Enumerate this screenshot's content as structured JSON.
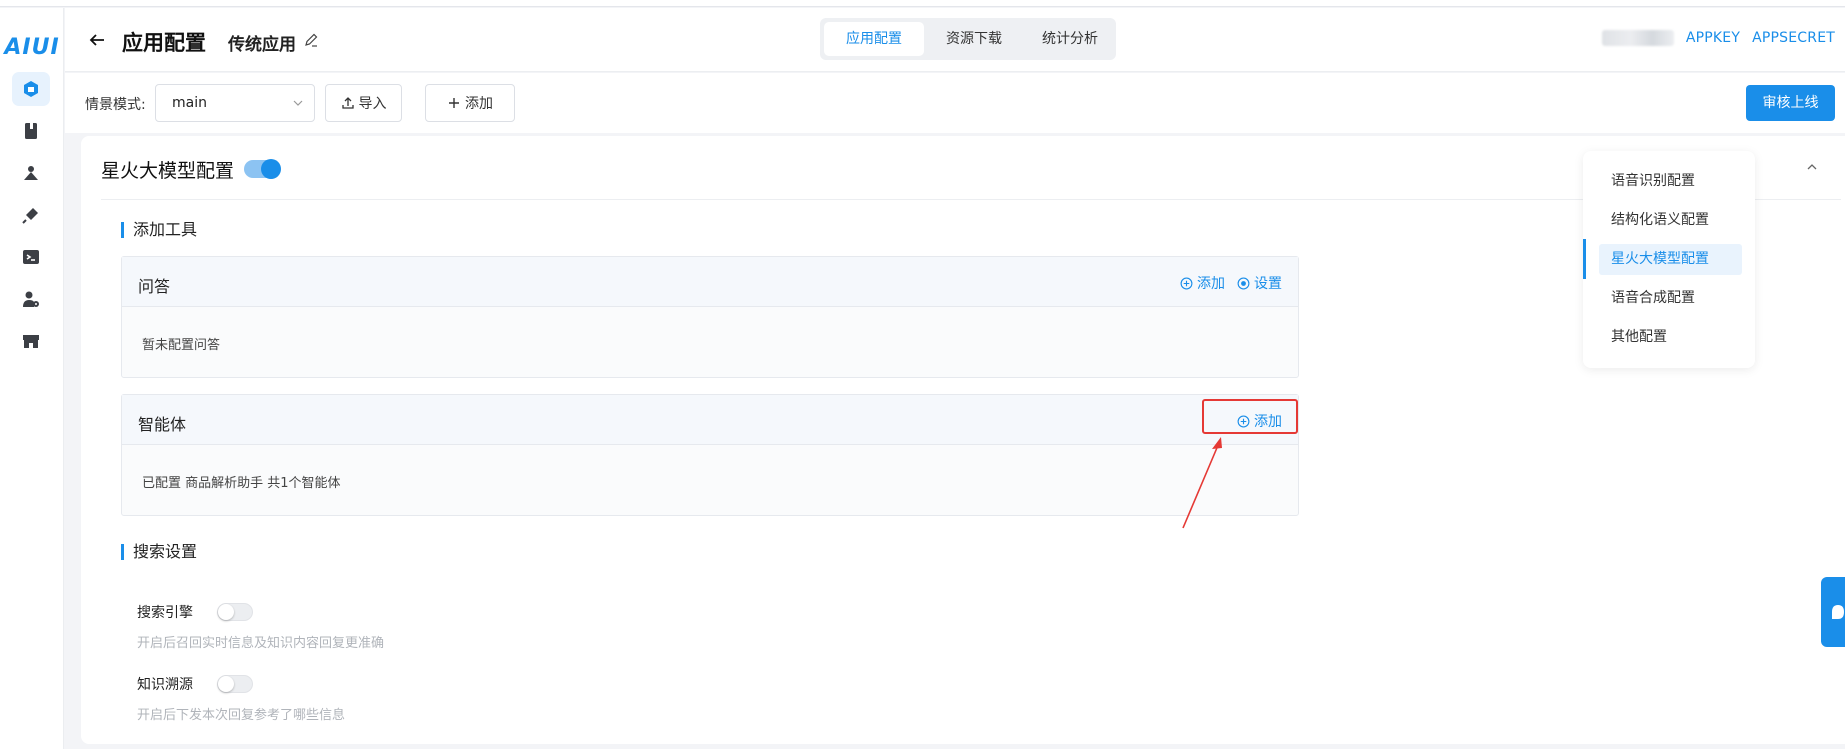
{
  "logo": {
    "text": "AIUI"
  },
  "header": {
    "page_title": "应用配置",
    "app_name": "传统应用",
    "tabs": [
      {
        "label": "应用配置",
        "active": true
      },
      {
        "label": "资源下载",
        "active": false
      },
      {
        "label": "统计分析",
        "active": false
      }
    ],
    "appkey_label": "APPKEY",
    "appsecret_label": "APPSECRET"
  },
  "toolbar": {
    "scene_label": "情景模式:",
    "scene_value": "main",
    "import_label": "导入",
    "add_label": "添加",
    "review_label": "审核上线"
  },
  "main": {
    "section_title": "星火大模型配置",
    "section_enabled": true,
    "tools_group_label": "添加工具",
    "qa": {
      "title": "问答",
      "add_label": "添加",
      "settings_label": "设置",
      "body_text": "暂未配置问答"
    },
    "agent": {
      "title": "智能体",
      "add_label": "添加",
      "body_text": "已配置 商品解析助手 共1个智能体"
    },
    "search_group_label": "搜索设置",
    "search_engine": {
      "label": "搜索引擎",
      "enabled": false,
      "desc": "开启后召回实时信息及知识内容回复更准确"
    },
    "knowledge_trace": {
      "label": "知识溯源",
      "enabled": false,
      "desc": "开启后下发本次回复参考了哪些信息"
    }
  },
  "anchor_nav": {
    "items": [
      {
        "label": "语音识别配置",
        "active": false
      },
      {
        "label": "结构化语义配置",
        "active": false
      },
      {
        "label": "星火大模型配置",
        "active": true
      },
      {
        "label": "语音合成配置",
        "active": false
      },
      {
        "label": "其他配置",
        "active": false
      }
    ]
  },
  "colors": {
    "accent": "#1a8ee9",
    "highlight": "#e53935",
    "background": "#f3f4f7"
  },
  "icons": {
    "rail": [
      "app-config-icon",
      "book-icon",
      "model-icon",
      "plugin-icon",
      "terminal-icon",
      "user-settings-icon",
      "store-icon"
    ],
    "float": "chat-support-icon"
  }
}
